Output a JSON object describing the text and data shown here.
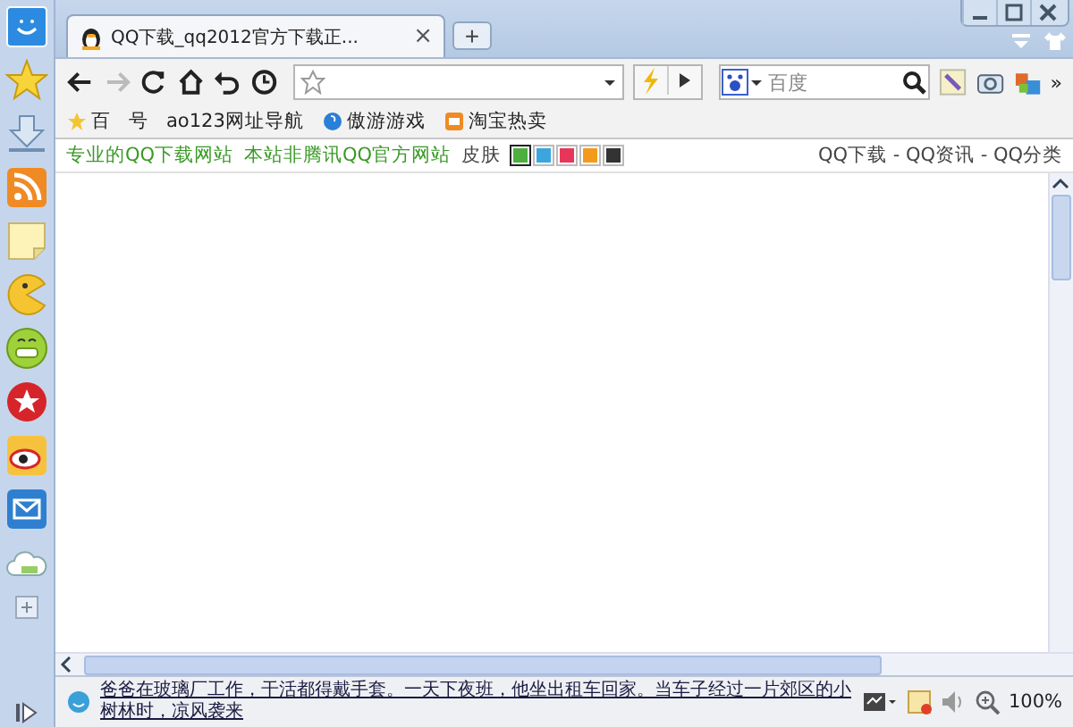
{
  "tab": {
    "title": "QQ下载_qq2012官方下载正...",
    "close": "×",
    "new_tab": "+"
  },
  "search": {
    "placeholder": "百度"
  },
  "more": "»",
  "bookmarks": [
    {
      "label": "百"
    },
    {
      "label": "号"
    },
    {
      "label": "ao123网址导航"
    },
    {
      "label": "傲游游戏"
    },
    {
      "label": "淘宝热卖"
    }
  ],
  "info_bar": {
    "links": [
      "专业的QQ下载网站",
      "本站非腾讯QQ官方网站"
    ],
    "skin_label": "皮肤",
    "skins": [
      {
        "color": "#4caf3e",
        "selected": true
      },
      {
        "color": "#3aa6dd",
        "selected": false
      },
      {
        "color": "#e8365a",
        "selected": false
      },
      {
        "color": "#f39a1a",
        "selected": false
      },
      {
        "color": "#333333",
        "selected": false
      }
    ],
    "nav": "QQ下载 - QQ资讯 - QQ分类"
  },
  "status": {
    "news": "爸爸在玻璃厂工作，干活都得戴手套。一天下夜班，他坐出租车回家。当车子经过一片郊区的小树林时，凉风袭来",
    "zoom": "100%"
  }
}
